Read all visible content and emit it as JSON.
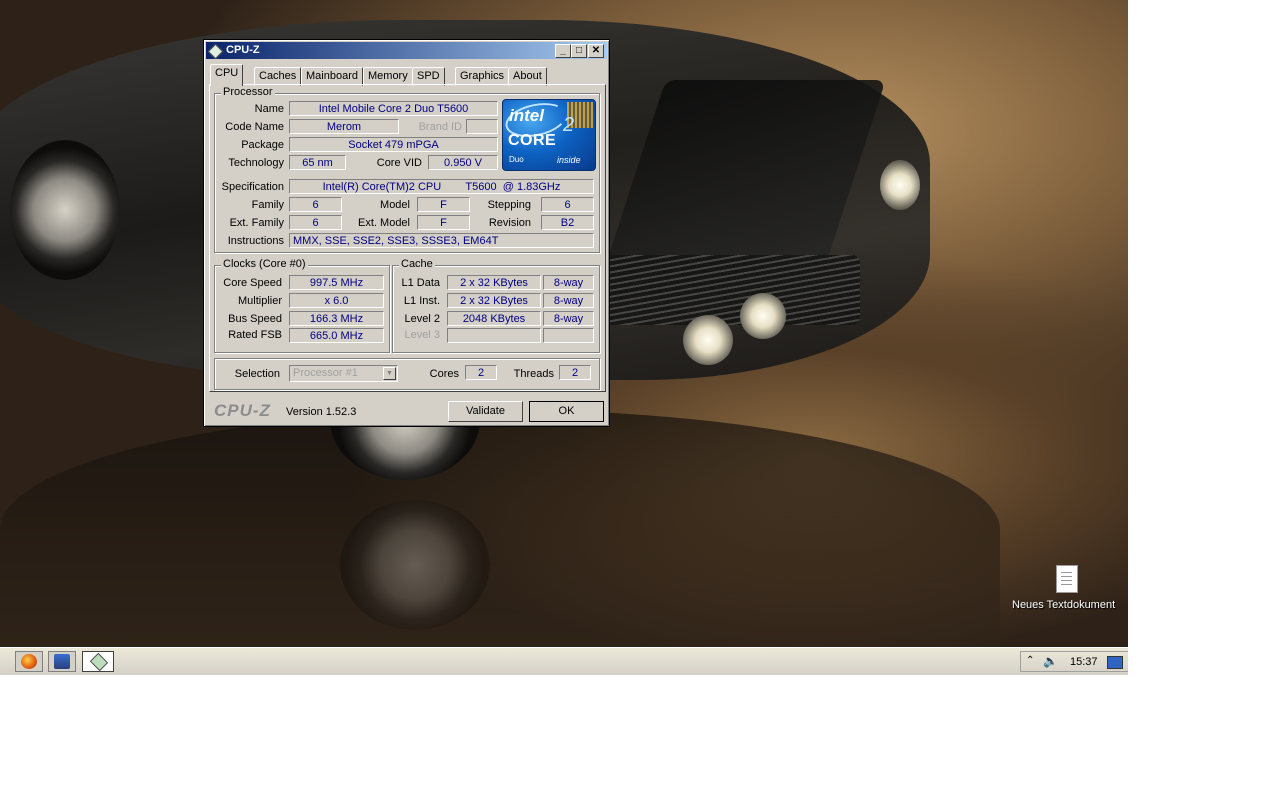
{
  "window": {
    "title": "CPU-Z",
    "tabs": [
      "CPU",
      "Caches",
      "Mainboard",
      "Memory",
      "SPD",
      "Graphics",
      "About"
    ],
    "active_tab": "CPU"
  },
  "processor": {
    "group_label": "Processor",
    "name_label": "Name",
    "name": "Intel Mobile Core 2 Duo T5600",
    "codename_label": "Code Name",
    "codename": "Merom",
    "brandid_label": "Brand ID",
    "brandid": "",
    "package_label": "Package",
    "package": "Socket 479 mPGA",
    "technology_label": "Technology",
    "technology": "65 nm",
    "corevid_label": "Core VID",
    "corevid": "0.950 V",
    "spec_label": "Specification",
    "spec": "Intel(R) Core(TM)2 CPU        T5600  @ 1.83GHz",
    "family_label": "Family",
    "family": "6",
    "model_label": "Model",
    "model": "F",
    "stepping_label": "Stepping",
    "stepping": "6",
    "extfamily_label": "Ext. Family",
    "extfamily": "6",
    "extmodel_label": "Ext. Model",
    "extmodel": "F",
    "revision_label": "Revision",
    "revision": "B2",
    "instructions_label": "Instructions",
    "instructions": "MMX, SSE, SSE2, SSE3, SSSE3, EM64T"
  },
  "logo": {
    "intel": "intel",
    "core": "CORE",
    "two": "2",
    "duo": "Duo",
    "inside": "inside"
  },
  "clocks": {
    "group_label": "Clocks (Core #0)",
    "corespeed_label": "Core Speed",
    "corespeed": "997.5 MHz",
    "multiplier_label": "Multiplier",
    "multiplier": "x 6.0",
    "busspeed_label": "Bus Speed",
    "busspeed": "166.3 MHz",
    "ratedfsb_label": "Rated FSB",
    "ratedfsb": "665.0 MHz"
  },
  "cache": {
    "group_label": "Cache",
    "l1data_label": "L1 Data",
    "l1data": "2 x 32 KBytes",
    "l1data_way": "8-way",
    "l1inst_label": "L1 Inst.",
    "l1inst": "2 x 32 KBytes",
    "l1inst_way": "8-way",
    "level2_label": "Level 2",
    "level2": "2048 KBytes",
    "level2_way": "8-way",
    "level3_label": "Level 3",
    "level3": "",
    "level3_way": ""
  },
  "selection": {
    "selection_label": "Selection",
    "selection_value": "Processor #1",
    "cores_label": "Cores",
    "cores": "2",
    "threads_label": "Threads",
    "threads": "2"
  },
  "footer": {
    "brand": "CPU-Z",
    "version": "Version 1.52.3",
    "validate": "Validate",
    "ok": "OK"
  },
  "desktop": {
    "icon_label": "Neues Textdokument"
  },
  "taskbar": {
    "clock": "15:37"
  },
  "colors": {
    "title_gradient_start": "#0a246a",
    "title_gradient_end": "#a6caf0",
    "value_text": "#000080",
    "window_face": "#d4d0c8"
  }
}
